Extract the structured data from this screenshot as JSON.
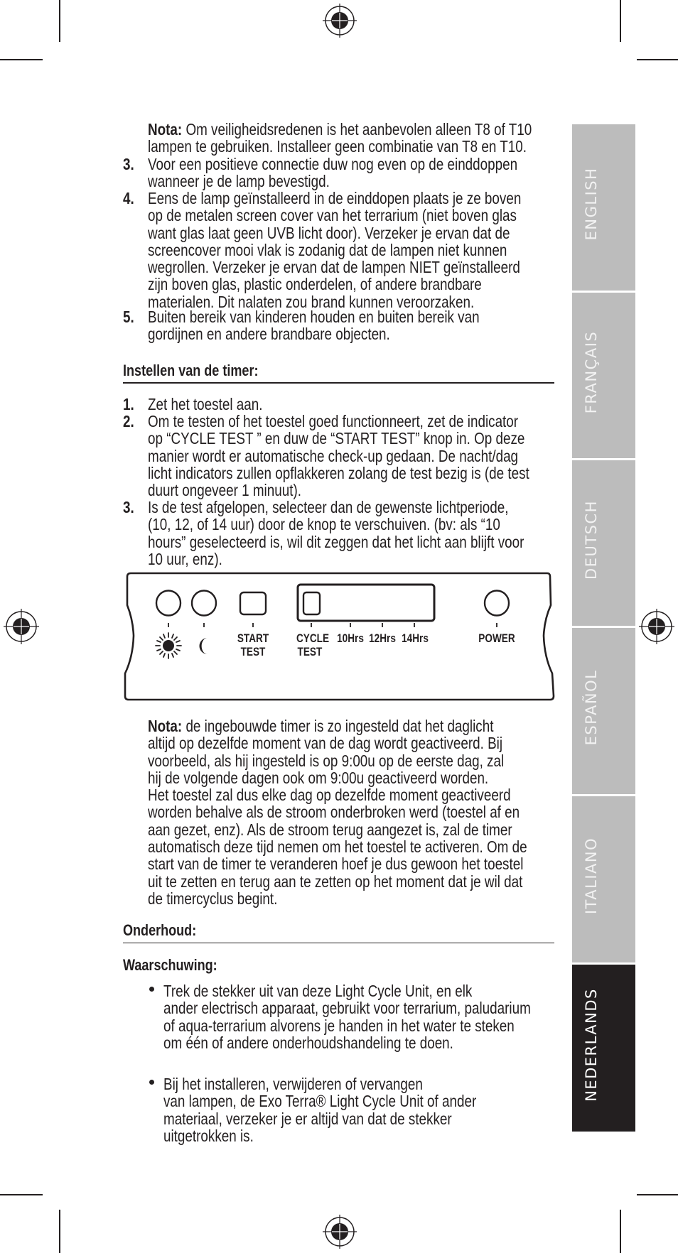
{
  "intro": {
    "note_label": "Nota:",
    "note_lines": [
      " Om veiligheidsredenen is het aanbevolen alleen T8 of T10",
      "lampen te gebruiken. Installeer geen combinatie van T8 en T10."
    ],
    "items": [
      {
        "number": "3.",
        "lines": [
          "Voor een positieve connectie duw nog even op de einddoppen",
          "wanneer je de lamp bevestigd."
        ]
      },
      {
        "number": "4.",
        "lines": [
          "Eens de lamp geïnstalleerd in de einddopen plaats je ze boven",
          "op de metalen screen cover van het terrarium (niet boven glas",
          "want glas laat geen UVB licht door).  Verzeker je ervan dat de",
          "screencover mooi vlak is zodanig dat de lampen niet kunnen",
          "wegrollen. Verzeker je ervan dat de lampen NIET geïnstalleerd",
          "zijn boven glas, plastic onderdelen, of andere brandbare",
          "materialen. Dit nalaten zou brand kunnen veroorzaken."
        ]
      },
      {
        "number": "5.",
        "lines": [
          "Buiten bereik van kinderen houden en buiten bereik van",
          "gordijnen en andere brandbare objecten."
        ]
      }
    ]
  },
  "timer_section": {
    "heading": "Instellen van de timer:",
    "items": [
      {
        "number": "1.",
        "lines": [
          "Zet het toestel aan."
        ]
      },
      {
        "number": "2.",
        "lines": [
          "Om te testen of het toestel goed functionneert, zet de indicator",
          "op “CYCLE TEST ” en duw de “START TEST” knop in. Op deze",
          "manier wordt er automatische check-up gedaan. De nacht/dag",
          "licht indicators zullen opflakkeren zolang de test bezig is (de test",
          "duurt ongeveer 1 minuut)."
        ]
      },
      {
        "number": "3.",
        "lines": [
          "Is de test afgelopen, selecteer dan de gewenste lichtperiode,",
          "(10, 12, of 14 uur) door de knop te verschuiven. (bv: als “10",
          "hours” geselecteerd is, wil dit zeggen dat het licht aan blijft voor",
          "10 uur, enz)."
        ]
      }
    ]
  },
  "control_panel": {
    "day_indicator_icon": "sun-icon",
    "night_indicator_icon": "moon-icon",
    "start_test_label": [
      "START",
      "TEST"
    ],
    "cycle_test_label": [
      "CYCLE",
      "TEST"
    ],
    "hour_options": [
      "10Hrs",
      "12Hrs",
      "14Hrs"
    ],
    "selected_position": "CYCLE TEST",
    "power_label": "POWER"
  },
  "timer_note": {
    "note_label": "Nota:",
    "lines": [
      " de ingebouwde timer is zo ingesteld dat het daglicht",
      "altijd op dezelfde moment van de dag wordt geactiveerd. Bij",
      "voorbeeld, als hij ingesteld is op 9:00u op de eerste dag, zal",
      "hij de volgende dagen ook om 9:00u geactiveerd worden.",
      "Het toestel zal dus elke dag op dezelfde moment geactiveerd",
      "worden behalve als de stroom onderbroken werd (toestel af en",
      "aan gezet, enz).  Als de stroom terug aangezet is, zal de timer",
      "automatisch deze tijd nemen om het toestel te activeren. Om de",
      "start van de timer te veranderen hoef je dus gewoon het toestel",
      "uit te zetten en terug aan te zetten op het moment dat je wil dat",
      "de timercyclus begint."
    ]
  },
  "maintenance": {
    "heading": "Onderhoud:",
    "warning_heading": "Waarschuwing:",
    "bullets": [
      {
        "lines": [
          "Trek de stekker uit van deze Light Cycle Unit, en elk",
          "ander electrisch apparaat, gebruikt voor terrarium, paludarium",
          "of aqua-terrarium alvorens je handen in het water te steken",
          "om één of andere onderhoudshandeling te doen."
        ]
      },
      {
        "lines": [
          "Bij het installeren, verwijderen of vervangen",
          "van lampen, de Exo Terra® Light Cycle Unit of ander",
          "materiaal, verzeker je er altijd van dat de stekker",
          "uitgetrokken is."
        ]
      }
    ]
  },
  "language_tabs": [
    {
      "label": "ENGLISH",
      "active": false
    },
    {
      "label": "FRANÇAIS",
      "active": false
    },
    {
      "label": "DEUTSCH",
      "active": false
    },
    {
      "label": "ESPAÑOL",
      "active": false
    },
    {
      "label": "ITALIANO",
      "active": false
    },
    {
      "label": "NEDERLANDS",
      "active": true
    }
  ],
  "colors": {
    "text": "#231f20",
    "tab_inactive": "#bcbcbc",
    "tab_active": "#231f20",
    "tab_text": "#f2f2f2"
  }
}
